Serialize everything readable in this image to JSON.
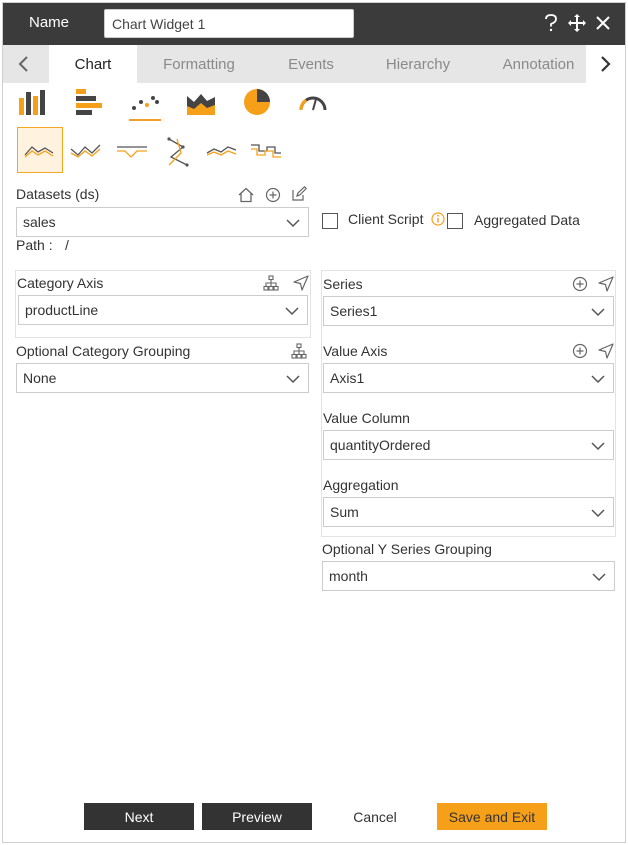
{
  "header": {
    "name_label": "Name",
    "name_value": "Chart Widget 1",
    "icons": [
      "help-icon",
      "move-icon",
      "close-icon"
    ]
  },
  "tabs": [
    {
      "label": "Chart",
      "active": true
    },
    {
      "label": "Formatting",
      "active": false
    },
    {
      "label": "Events",
      "active": false
    },
    {
      "label": "Hierarchy",
      "active": false
    },
    {
      "label": "Annotation",
      "active": false
    }
  ],
  "chart_types": [
    "bar-chart-icon",
    "horizontal-bar-chart-icon",
    "scatter-chart-icon",
    "area-chart-icon",
    "pie-chart-icon",
    "gauge-chart-icon"
  ],
  "chart_subtypes": [
    "line-chart-icon",
    "line-markers-chart-icon",
    "step-area-chart-icon",
    "scatter-line-chart-icon",
    "smooth-line-chart-icon",
    "step-line-chart-icon"
  ],
  "datasets": {
    "label": "Datasets (ds)",
    "value": "sales",
    "path_label": "Path :",
    "path_value": "/"
  },
  "options": {
    "client_script": "Client Script",
    "aggregated_data": "Aggregated Data"
  },
  "category_axis": {
    "label": "Category Axis",
    "value": "productLine"
  },
  "category_grouping": {
    "label": "Optional Category Grouping",
    "value": "None"
  },
  "series": {
    "label": "Series",
    "value": "Series1"
  },
  "value_axis": {
    "label": "Value Axis",
    "value": "Axis1"
  },
  "value_column": {
    "label": "Value Column",
    "value": "quantityOrdered"
  },
  "aggregation": {
    "label": "Aggregation",
    "value": "Sum"
  },
  "y_series_grouping": {
    "label": "Optional Y Series Grouping",
    "value": "month"
  },
  "footer": {
    "next": "Next",
    "preview": "Preview",
    "cancel": "Cancel",
    "save_exit": "Save and Exit"
  },
  "colors": {
    "accent": "#f6a01a",
    "dark": "#333333",
    "header": "#3b3b3b"
  }
}
